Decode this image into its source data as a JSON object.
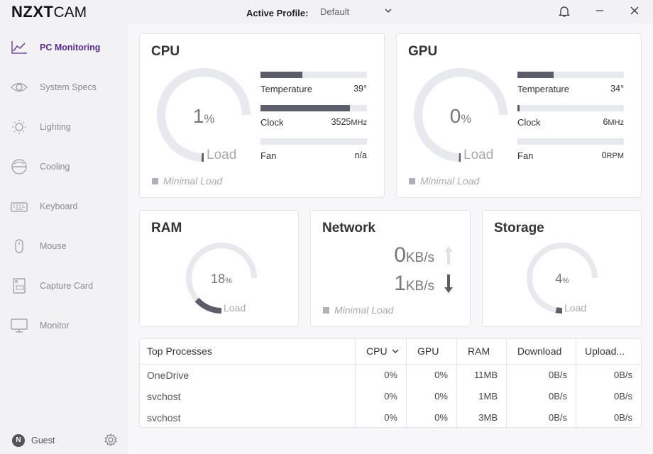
{
  "app": {
    "brand_bold": "NZXT",
    "brand_light": "CAM"
  },
  "titlebar": {
    "profile_label": "Active Profile:",
    "profile_value": "Default",
    "icons": [
      "bell-icon",
      "minimize-icon",
      "close-icon"
    ]
  },
  "sidebar": {
    "items": [
      {
        "label": "PC Monitoring",
        "icon": "line-chart-icon",
        "active": true
      },
      {
        "label": "System Specs",
        "icon": "eye-icon",
        "active": false
      },
      {
        "label": "Lighting",
        "icon": "sun-icon",
        "active": false
      },
      {
        "label": "Cooling",
        "icon": "fan-icon",
        "active": false
      },
      {
        "label": "Keyboard",
        "icon": "keyboard-icon",
        "active": false
      },
      {
        "label": "Mouse",
        "icon": "mouse-icon",
        "active": false
      },
      {
        "label": "Capture Card",
        "icon": "capture-card-icon",
        "active": false
      },
      {
        "label": "Monitor",
        "icon": "monitor-icon",
        "active": false
      }
    ],
    "user": {
      "initial": "N",
      "name": "Guest"
    }
  },
  "cpu": {
    "title": "CPU",
    "gauge": {
      "value": "1",
      "unit": "%",
      "caption": "Load",
      "fraction": 0.01
    },
    "temperature": {
      "label": "Temperature",
      "value": "39°",
      "fraction": 0.39
    },
    "clock": {
      "label": "Clock",
      "value": "3525",
      "unit": "MHz",
      "fraction": 0.84
    },
    "fan": {
      "label": "Fan",
      "value": "n/a",
      "fraction": 0
    },
    "status": "Minimal Load"
  },
  "gpu": {
    "title": "GPU",
    "gauge": {
      "value": "0",
      "unit": "%",
      "caption": "Load",
      "fraction": 0
    },
    "temperature": {
      "label": "Temperature",
      "value": "34°",
      "fraction": 0.34
    },
    "clock": {
      "label": "Clock",
      "value": "6",
      "unit": "MHz",
      "fraction": 0.02
    },
    "fan": {
      "label": "Fan",
      "value": "0",
      "unit": "RPM",
      "fraction": 0
    },
    "status": "Minimal Load"
  },
  "ram": {
    "title": "RAM",
    "gauge": {
      "value": "18",
      "unit": "%",
      "caption": "Load",
      "fraction": 0.18
    }
  },
  "network": {
    "title": "Network",
    "upload": {
      "value": "0",
      "unit": "KB/s"
    },
    "download": {
      "value": "1",
      "unit": "KB/s"
    },
    "status": "Minimal Load"
  },
  "storage": {
    "title": "Storage",
    "gauge": {
      "value": "4",
      "unit": "%",
      "caption": "Load",
      "fraction": 0.04
    }
  },
  "processes": {
    "headers": [
      "Top Processes",
      "CPU",
      "GPU",
      "RAM",
      "Download",
      "Upload..."
    ],
    "rows": [
      {
        "name": "OneDrive",
        "cpu": "0%",
        "gpu": "0%",
        "ram": "11MB",
        "download": "0B/s",
        "upload": "0B/s"
      },
      {
        "name": "svchost",
        "cpu": "0%",
        "gpu": "0%",
        "ram": "1MB",
        "download": "0B/s",
        "upload": "0B/s"
      },
      {
        "name": "svchost",
        "cpu": "0%",
        "gpu": "0%",
        "ram": "3MB",
        "download": "0B/s",
        "upload": "0B/s"
      }
    ]
  },
  "colors": {
    "accent": "#5a2a8c",
    "bar_fill": "#5d5c6a",
    "track": "#e8e9ee"
  }
}
